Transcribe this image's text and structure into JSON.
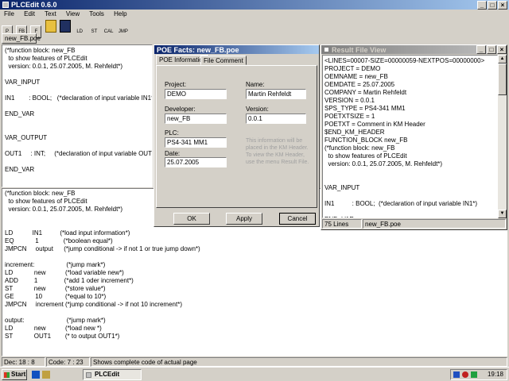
{
  "app": {
    "title": "PLCEdit 0.6.0",
    "menu": [
      "File",
      "Edit",
      "Text",
      "View",
      "Tools",
      "Help"
    ],
    "toolbar": [
      "P",
      "FB",
      "F",
      "LD",
      "ST",
      "CAL",
      "JMP"
    ],
    "doc_tab": "new_FB.poe"
  },
  "editor_top": {
    "text": "(*function block: new_FB\n  to show features of PLCEdit\n  version: 0.0.1, 25.07.2005, M. Rehfeldt*)\n\nVAR_INPUT\n\nIN1        : BOOL;   (*declaration of input variable IN1*)\n\nEND_VAR\n\n\nVAR_OUTPUT\n\nOUT1     : INT;     (*declaration of input variable OUT1*)\n\nEND_VAR\n\n\nVAR"
  },
  "editor_bottom": {
    "text": "(*function block: new_FB\n  to show features of PLCEdit\n  version: 0.0.1, 25.07.2005, M. Rehfeldt*)\n\n\nLD           IN1          (*load input information*)\nEQ            1              (*boolean equal*)\nJMPCN     output      (*jump conditional -> if not 1 or true jump down*)\n\nincrement:                  (*jump mark*)\nLD            new           (*load variable new*)\nADD         1               (*add 1 oder increment*)\nST            new           (*store value*)\nGE            10             (*equal to 10*)\nJMPCN     increment (*jump conditional -> if not 10 increment*)\n\noutput:                        (*jump mark*)\nLD            new           (*load new *)\nST            OUT1        (* to output OUT1*)"
  },
  "dialog": {
    "title": "POE Facts: new_FB.poe",
    "tabs": [
      "POE Information",
      "File Comment"
    ],
    "project_label": "Project:",
    "project_value": "DEMO",
    "name_label": "Name:",
    "name_value": "Martin Rehfeldt",
    "developer_label": "Developer:",
    "developer_value": "new_FB",
    "version_label": "Version:",
    "version_value": "0.0.1",
    "plc_label": "PLC:",
    "plc_value": "PS4-341 MM1",
    "date_label": "Date:",
    "date_value": "25.07.2005",
    "info_text": "This information will be\nplaced in the KM Header.\nTo view the KM Header,\nuse the menu Result File.",
    "ok": "OK",
    "apply": "Apply",
    "cancel": "Cancel"
  },
  "result_view": {
    "title": "Result File View",
    "text": "<LINES=00007-SIZE=00000059-NEXTPOS=00000000>\nPROJECT = DEMO\nOEMNAME = new_FB\nOEMDATE = 25.07.2005\nCOMPANY = Martin Rehfeldt\nVERSION = 0.0.1\nSPS_TYPE = PS4-341 MM1\nPOETXTSIZE = 1\nPOETXT = Comment in KM Header\n$END_KM_HEADER\nFUNCTION_BLOCK new_FB\n(*function block: new_FB\n  to show features of PLCEdit\n  version: 0.0.1, 25.07.2005, M. Rehfeldt*)\n\n\nVAR_INPUT\n\nIN1          : BOOL;  (*declaration of input variable IN1*)\n\nEND_VAR",
    "status_lines": "75 Lines",
    "status_file": "new_FB.poe"
  },
  "statusbar": {
    "dec": "Dec: 18 : 8",
    "code": "Code: 7 : 23",
    "message": "Shows complete code of actual page"
  },
  "taskbar": {
    "start": "Start",
    "task": "PLCEdit",
    "clock": "19:18"
  }
}
